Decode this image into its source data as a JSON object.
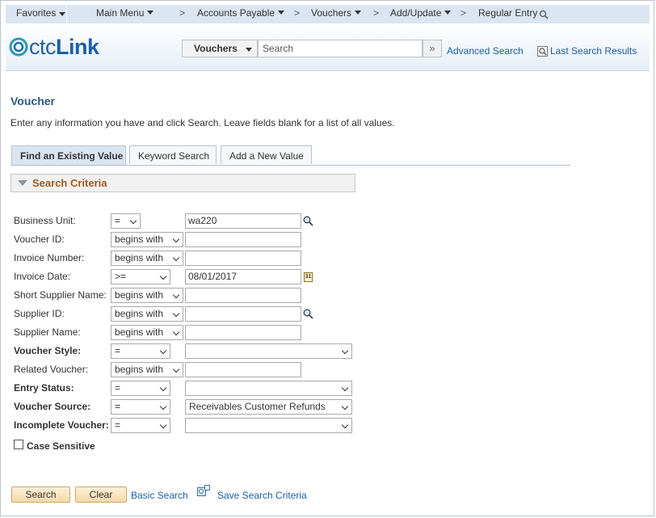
{
  "topnav": {
    "favorites": "Favorites",
    "main_menu": "Main Menu",
    "accounts_payable": "Accounts Payable",
    "vouchers": "Vouchers",
    "add_update": "Add/Update",
    "regular_entry": "Regular Entry",
    "separator": ">"
  },
  "header": {
    "logo_ctc": "ctc",
    "logo_link": "Link",
    "search_category": "Vouchers",
    "search_placeholder": "Search",
    "advanced_search": "Advanced Search",
    "last_search_results": "Last Search Results"
  },
  "page": {
    "title": "Voucher",
    "instructions": "Enter any information you have and click Search. Leave fields blank for a list of all values."
  },
  "tabs": {
    "find_existing": "Find an Existing Value",
    "keyword_search": "Keyword Search",
    "add_new": "Add a New Value"
  },
  "criteria": {
    "header": "Search Criteria",
    "business_unit": {
      "label": "Business Unit:",
      "op": "=",
      "value": "wa220"
    },
    "voucher_id": {
      "label": "Voucher ID:",
      "op": "begins with",
      "value": ""
    },
    "invoice_number": {
      "label": "Invoice Number:",
      "op": "begins with",
      "value": ""
    },
    "invoice_date": {
      "label": "Invoice Date:",
      "op": ">=",
      "value": "08/01/2017"
    },
    "short_supplier_name": {
      "label": "Short Supplier Name:",
      "op": "begins with",
      "value": ""
    },
    "supplier_id": {
      "label": "Supplier ID:",
      "op": "begins with",
      "value": ""
    },
    "supplier_name": {
      "label": "Supplier Name:",
      "op": "begins with",
      "value": ""
    },
    "voucher_style": {
      "label": "Voucher Style:",
      "op": "=",
      "value": ""
    },
    "related_voucher": {
      "label": "Related Voucher:",
      "op": "begins with",
      "value": ""
    },
    "entry_status": {
      "label": "Entry Status:",
      "op": "=",
      "value": ""
    },
    "voucher_source": {
      "label": "Voucher Source:",
      "op": "=",
      "value": "Receivables Customer Refunds"
    },
    "incomplete_voucher": {
      "label": "Incomplete Voucher:",
      "op": "=",
      "value": ""
    },
    "case_sensitive": "Case Sensitive"
  },
  "actions": {
    "search": "Search",
    "clear": "Clear",
    "basic_search": "Basic Search",
    "save_search_criteria": "Save Search Criteria"
  },
  "colors": {
    "nav_bg": "#dbe5f1",
    "link": "#1b5fa8",
    "title": "#2b5b8a",
    "criteria_header": "#a05a1e",
    "button_bg": "#f4d9a8"
  },
  "icons": {
    "lookup": "magnifier-icon",
    "calendar": "calendar-icon",
    "advanced_search_icon": "search-next-icon"
  }
}
